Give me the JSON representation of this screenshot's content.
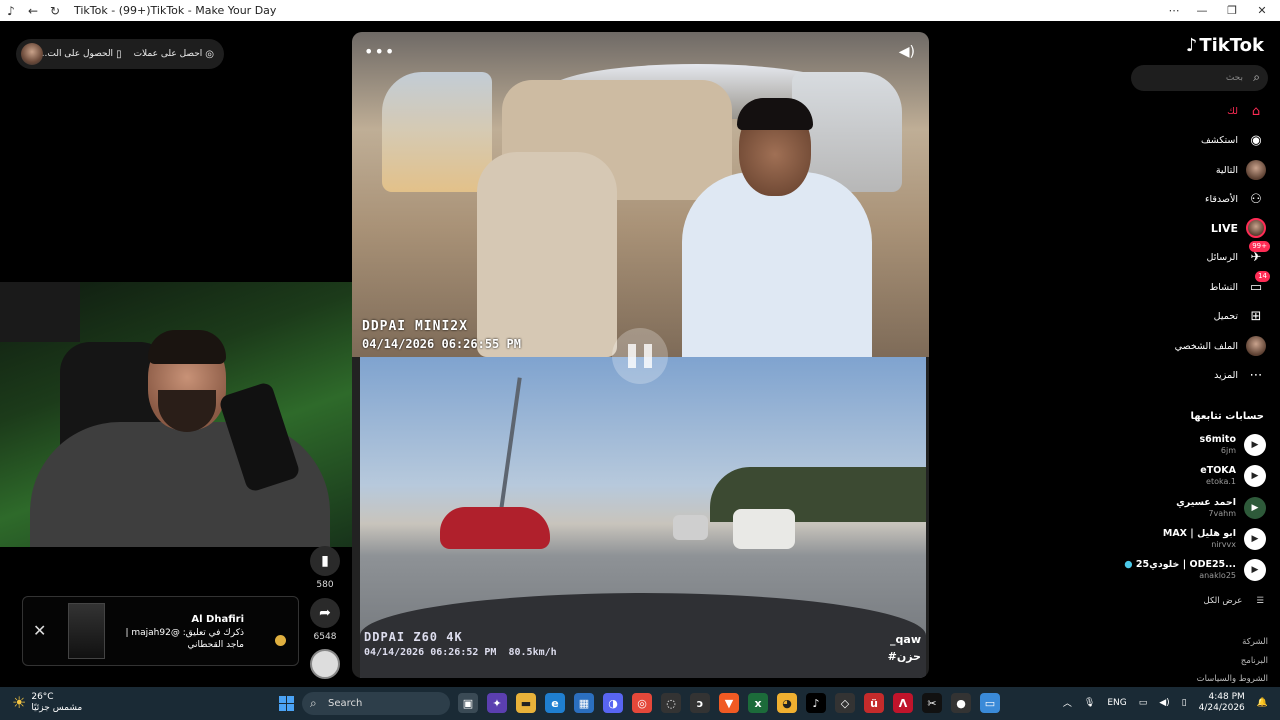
{
  "window": {
    "title": "TikTok - (99+)TikTok - Make Your Day"
  },
  "top_pill": {
    "item1": "احصل على عملات",
    "item2": "الحصول على الت..."
  },
  "video": {
    "top_brand": "DDPAI MINI2X",
    "top_stamp": "04/14/2026 06:26:55 PM",
    "bottom_brand": "DDPAI Z60 4K",
    "bottom_stamp": "04/14/2026 06:26:52 PM",
    "speed": "80.5km/h",
    "username": "_qaw",
    "hashtag": "#حزن",
    "progress_fraction": 0.17
  },
  "actions": {
    "save_count": "580",
    "share_count": "6548"
  },
  "notification": {
    "title": "Al Dhafiri",
    "line1": "ذكرك في تعليق: @majah92 |",
    "line2": "ماجد القحطاني"
  },
  "sidebar": {
    "logo": "TikTok",
    "search_placeholder": "بحث",
    "nav": [
      {
        "label": "لك",
        "icon": "home-icon"
      },
      {
        "label": "استكشف",
        "icon": "compass-icon"
      },
      {
        "label": "التالية",
        "icon": "avatar-icon"
      },
      {
        "label": "الأصدقاء",
        "icon": "friends-icon"
      },
      {
        "label": "LIVE",
        "icon": "live-icon"
      },
      {
        "label": "الرسائل",
        "icon": "message-icon",
        "badge": "99+"
      },
      {
        "label": "النشاط",
        "icon": "activity-icon",
        "badge": "14"
      },
      {
        "label": "تحميل",
        "icon": "upload-icon"
      },
      {
        "label": "الملف الشخصي",
        "icon": "profile-icon"
      },
      {
        "label": "المزيد",
        "icon": "more-icon"
      }
    ],
    "following_title": "حسابات تتابعها",
    "following": [
      {
        "name": "s6mito",
        "handle": "6jm"
      },
      {
        "name": "eTOKA",
        "handle": "etoka.1"
      },
      {
        "name": "احمد عسيري",
        "handle": "7vahm"
      },
      {
        "name": "MAX | ابو هليل",
        "handle": "nirvvx"
      },
      {
        "name": "خلودي25 | ODE25...",
        "handle": "anaklo25"
      }
    ],
    "see_all": "عرض الكل",
    "footer": [
      "الشركة",
      "البرنامج",
      "الشروط والسياسات"
    ]
  },
  "taskbar": {
    "temp": "26°C",
    "weather": "مشمس جزئيًا",
    "search": "Search",
    "lang": "ENG",
    "time": "4:48 PM",
    "date": "4/24/2026"
  }
}
